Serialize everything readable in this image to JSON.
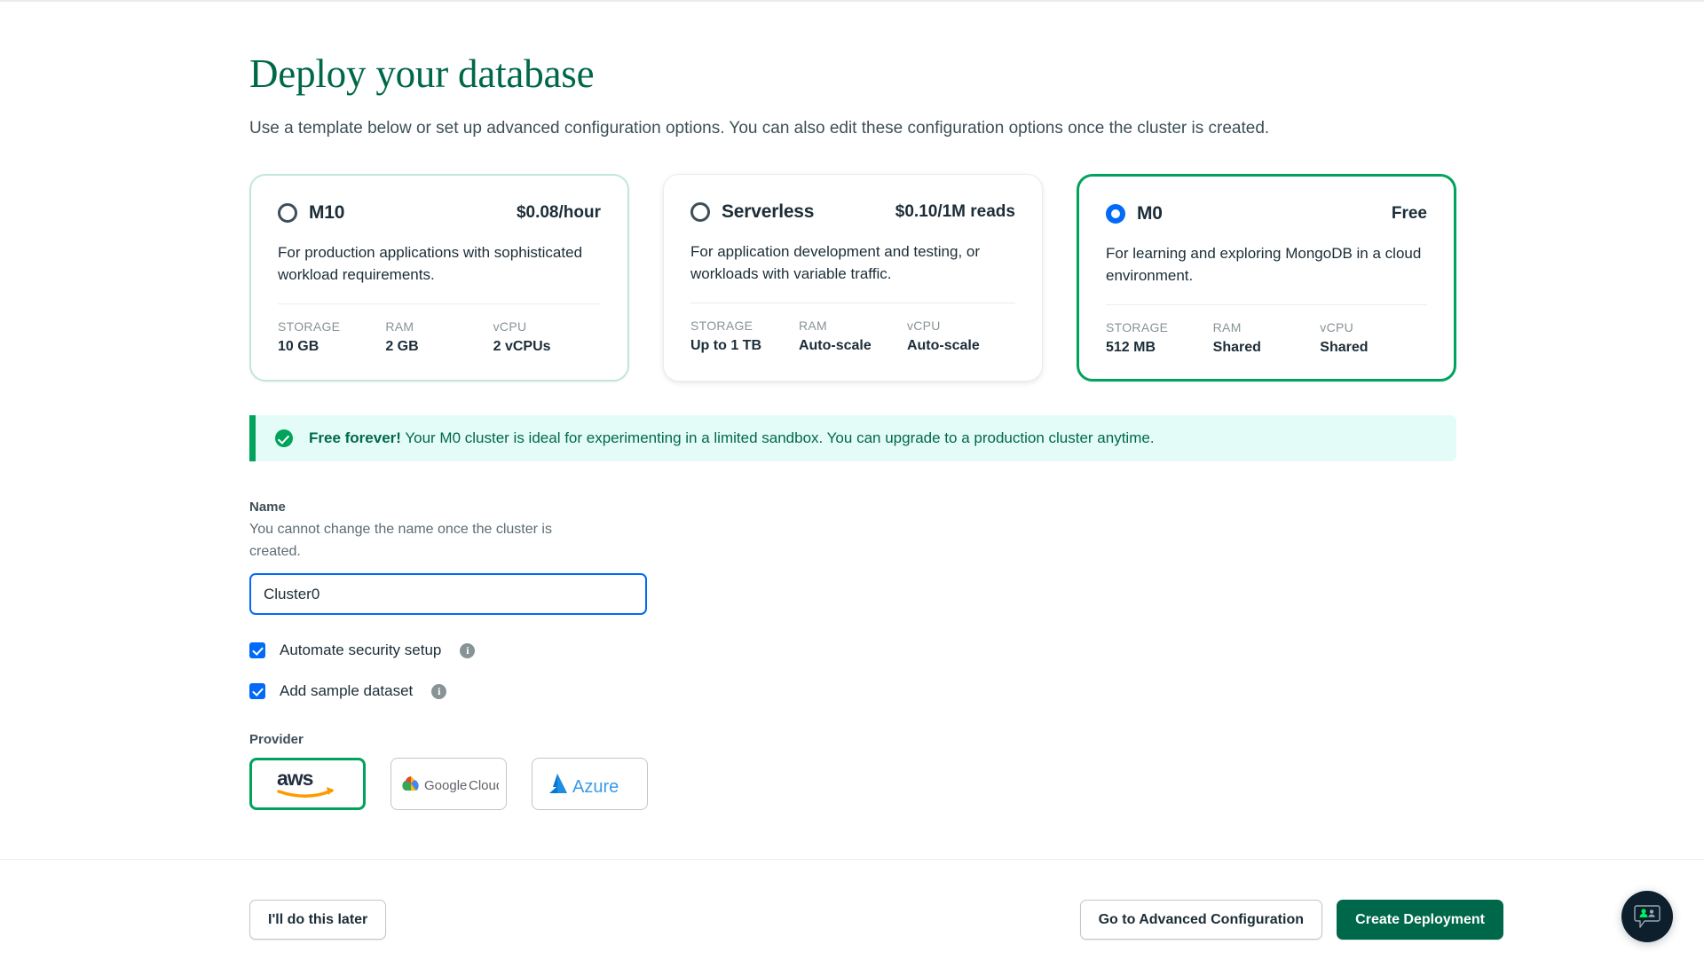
{
  "page": {
    "title": "Deploy your database",
    "subtitle": "Use a template below or set up advanced configuration options. You can also edit these configuration options once the cluster is created."
  },
  "tiers": [
    {
      "id": "m10",
      "name": "M10",
      "price": "$0.08/hour",
      "description": "For production applications with sophisticated workload requirements.",
      "selected": false,
      "specs": [
        {
          "label": "STORAGE",
          "value": "10 GB"
        },
        {
          "label": "RAM",
          "value": "2 GB"
        },
        {
          "label": "vCPU",
          "value": "2 vCPUs"
        }
      ]
    },
    {
      "id": "serverless",
      "name": "Serverless",
      "price": "$0.10/1M reads",
      "description": "For application development and testing, or workloads with variable traffic.",
      "selected": false,
      "specs": [
        {
          "label": "STORAGE",
          "value": "Up to 1 TB"
        },
        {
          "label": "RAM",
          "value": "Auto-scale"
        },
        {
          "label": "vCPU",
          "value": "Auto-scale"
        }
      ]
    },
    {
      "id": "m0",
      "name": "M0",
      "price": "Free",
      "description": "For learning and exploring MongoDB in a cloud environment.",
      "selected": true,
      "specs": [
        {
          "label": "STORAGE",
          "value": "512 MB"
        },
        {
          "label": "RAM",
          "value": "Shared"
        },
        {
          "label": "vCPU",
          "value": "Shared"
        }
      ]
    }
  ],
  "banner": {
    "icon": "check-circle-icon",
    "strong": "Free forever!",
    "text": " Your M0 cluster is ideal for experimenting in a limited sandbox. You can upgrade to a production cluster anytime."
  },
  "name_field": {
    "label": "Name",
    "help": "You cannot change the name once the cluster is created.",
    "value": "Cluster0",
    "placeholder": "Cluster0"
  },
  "checkboxes": [
    {
      "label": "Automate security setup",
      "checked": true,
      "info": "info-icon",
      "info_glyph": "i"
    },
    {
      "label": "Add sample dataset",
      "checked": true,
      "info": "info-icon",
      "info_glyph": "i"
    }
  ],
  "provider": {
    "label": "Provider",
    "options": [
      {
        "id": "aws",
        "name": "aws",
        "selected": true
      },
      {
        "id": "gcp",
        "name": "Google Cloud",
        "selected": false
      },
      {
        "id": "azure",
        "name": "Azure",
        "selected": false
      }
    ]
  },
  "footer": {
    "later_label": "I'll do this later",
    "advanced_label": "Go to Advanced Configuration",
    "create_label": "Create Deployment"
  },
  "chat": {
    "icon": "chat-people-icon"
  },
  "colors": {
    "brand_green_dark": "#00684A",
    "brand_green": "#00A35C",
    "pale_green_border": "#C3E7D6",
    "banner_bg": "#E3FCF7",
    "blue": "#016BF8",
    "text_dark": "#1C2D38",
    "text_muted": "#889397",
    "border_gray": "#E8EDEB",
    "fab_navy": "#0D1F2C"
  }
}
